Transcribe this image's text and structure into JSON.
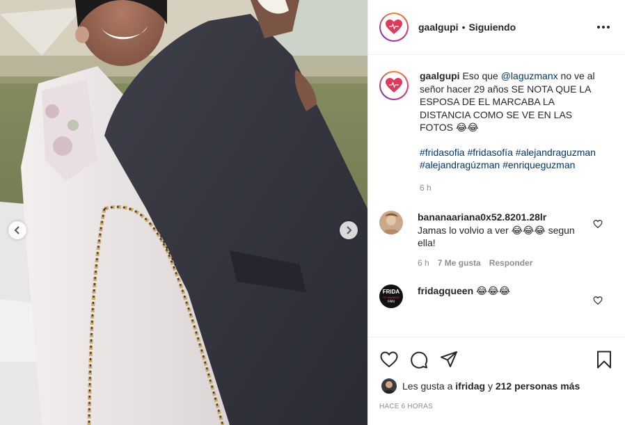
{
  "post": {
    "username": "gaalgupi",
    "separator": "•",
    "follow_status": "Siguiendo"
  },
  "caption": {
    "username": "gaalgupi",
    "text_1": "Eso que",
    "mention": "@laguzmanx",
    "text_2": "no ve al señor hacer 29 años SE NOTA QUE LA ESPOSA DE EL MARCABA LA DISTANCIA COMO SE VE EN LAS FOTOS 😂😂",
    "hashtags": [
      "#fridasofia",
      "#fridasofía",
      "#alejandraguzman",
      "#alejandragúzman",
      "#enriqueguzman"
    ],
    "time": "6 h"
  },
  "comments": [
    {
      "username": "bananaariana0x52.8201.28lr",
      "text": "Jamas lo volvio a ver 😂😂😂 segun ella!",
      "time": "6 h",
      "likes": "7 Me gusta",
      "reply_label": "Responder"
    },
    {
      "username": "fridagqueen",
      "text": "😂😂😂",
      "avatar_text": "FRIDA TE AMAMOS FAN"
    }
  ],
  "actions": {
    "icons": [
      "heart-icon",
      "comment-icon",
      "share-icon",
      "bookmark-icon"
    ]
  },
  "likes": {
    "prefix": "Les gusta a",
    "user": "ifridag",
    "middle": "y",
    "count": "212 personas más"
  },
  "posted_ago": "HACE 6 HORAS",
  "colors": {
    "link": "#00376b",
    "muted": "#8e8e8e",
    "text": "#262626",
    "border": "#efefef"
  }
}
